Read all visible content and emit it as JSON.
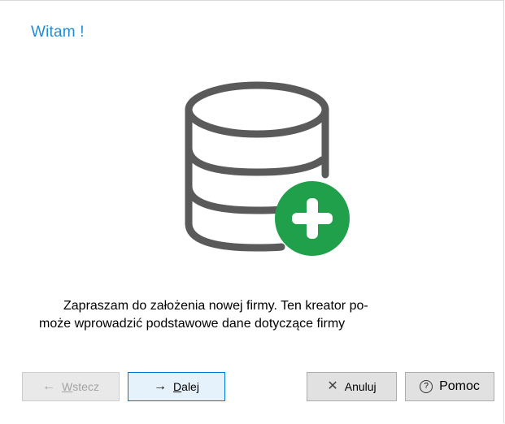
{
  "wizard": {
    "title": "Witam !",
    "message_line1": "Zapraszam do założenia nowej firmy. Ten kreator po-",
    "message_line2": "może wprowadzić podstawowe dane dotyczące firmy"
  },
  "buttons": {
    "back": {
      "arrow": "←",
      "label_first": "W",
      "label_rest": "stecz",
      "enabled": false
    },
    "next": {
      "arrow": "→",
      "label_first": "D",
      "label_rest": "alej",
      "enabled": true
    },
    "cancel": {
      "icon": "✕",
      "label": "Anuluj",
      "enabled": true
    },
    "help": {
      "icon": "?",
      "label": "Pomoc",
      "enabled": true
    }
  },
  "colors": {
    "title": "#1f8dd6",
    "database_icon": "#5a5a5a",
    "add_badge": "#21a04b"
  },
  "icons": {
    "illustration": "database-icon",
    "badge": "plus-circle-icon"
  }
}
